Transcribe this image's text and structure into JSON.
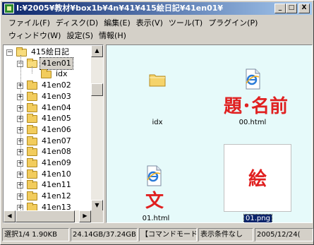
{
  "window": {
    "title": "I:¥2005¥教材¥box1b¥4n¥41¥415絵日記¥41en01¥",
    "controls": {
      "minimize": "_",
      "maximize": "□",
      "close": "X"
    }
  },
  "menu": {
    "row1": [
      "ファイル(F)",
      "ディスク(D)",
      "編集(E)",
      "表示(V)",
      "ツール(T)",
      "プラグイン(P)"
    ],
    "row2": [
      "ウィンドウ(W)",
      "設定(S)",
      "情報(H)"
    ]
  },
  "tree": {
    "items": [
      {
        "label": "415絵日記",
        "level": 0,
        "expander": "minus",
        "open": true
      },
      {
        "label": "41en01",
        "level": 1,
        "expander": "minus",
        "open": true,
        "selected": true
      },
      {
        "label": "idx",
        "level": 2,
        "expander": "none",
        "open": false
      },
      {
        "label": "41en02",
        "level": 1,
        "expander": "plus"
      },
      {
        "label": "41en03",
        "level": 1,
        "expander": "plus"
      },
      {
        "label": "41en04",
        "level": 1,
        "expander": "plus"
      },
      {
        "label": "41en05",
        "level": 1,
        "expander": "plus"
      },
      {
        "label": "41en06",
        "level": 1,
        "expander": "plus"
      },
      {
        "label": "41en07",
        "level": 1,
        "expander": "plus"
      },
      {
        "label": "41en08",
        "level": 1,
        "expander": "plus"
      },
      {
        "label": "41en09",
        "level": 1,
        "expander": "plus"
      },
      {
        "label": "41en10",
        "level": 1,
        "expander": "plus"
      },
      {
        "label": "41en11",
        "level": 1,
        "expander": "plus"
      },
      {
        "label": "41en12",
        "level": 1,
        "expander": "plus"
      },
      {
        "label": "41en13",
        "level": 1,
        "expander": "plus"
      }
    ]
  },
  "files": [
    {
      "name": "idx",
      "icon": "folder-icon",
      "overlay": ""
    },
    {
      "name": "00.html",
      "icon": "ie-document-icon",
      "overlay": "題･名前"
    },
    {
      "name": "01.html",
      "icon": "ie-document-icon",
      "overlay": "文"
    },
    {
      "name": "01.png",
      "icon": "image-thumbnail",
      "overlay": "絵",
      "selected": true
    }
  ],
  "status": {
    "selection": "選択1/4 1.90KB",
    "disk": "24.14GB/37.24GB",
    "mode": "【コマンドモード】",
    "filter": "表示条件なし",
    "date": "2005/12/24("
  },
  "colors": {
    "title_start": "#0a246a",
    "title_end": "#a6caf0",
    "file_pane_bg": "#e6fafa",
    "overlay_red": "#e02020",
    "selection_blue": "#0a246a"
  }
}
